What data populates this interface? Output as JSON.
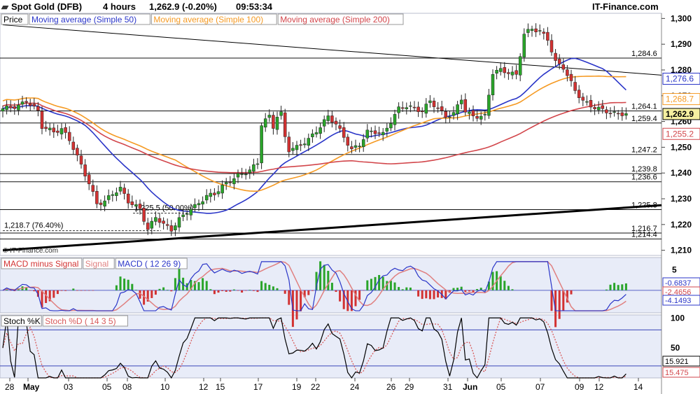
{
  "header": {
    "instrument": "Spot Gold (DFB)",
    "timeframe": "4 hours",
    "price": "1,262.9 (-0.20%)",
    "time": "09:53:34",
    "brand": "IT-Finance.com"
  },
  "colors": {
    "panel_bg": "#e8ecf8",
    "price_label_bg": "#f5f0a0",
    "ma50": "#2a35c8",
    "ma100": "#f59a23",
    "ma200": "#d2464b",
    "macd_line": "#2a35c8",
    "signal_line": "#e08080",
    "hist_pos": "#2aa52a",
    "hist_neg": "#d23232",
    "stoch_k": "#000000",
    "stoch_d": "#d85a5a",
    "candle_up": "#2aa52a",
    "candle_down": "#d23232"
  },
  "legends": {
    "price": [
      "Price",
      "Moving average (Simple 50)",
      "Moving average (Simple 100)",
      "Moving average (Simple 200)"
    ],
    "macd": [
      "MACD minus Signal",
      "Signal",
      "MACD ( 12 26 9)"
    ],
    "stoch": [
      "Stoch %K",
      "Stoch %D ( 14 3 5)"
    ]
  },
  "watermark": "© IT-Finance.com",
  "chart_data": {
    "type": "candlestick",
    "price_axis": {
      "range": [
        1208,
        1302
      ],
      "ticks": [
        "1,300",
        "1,290",
        "1,280",
        "1,270",
        "1,260",
        "1,250",
        "1,240",
        "1,230",
        "1,220",
        "1,210"
      ]
    },
    "x_ticks": [
      "28",
      "May",
      "03",
      "05",
      "08",
      "10",
      "12",
      "15",
      "17",
      "19",
      "22",
      "24",
      "26",
      "29",
      "31",
      "Jun",
      "05",
      "07",
      "09",
      "12",
      "14"
    ],
    "horizontal_levels": [
      {
        "value": 1284.6,
        "label": "1,284.6"
      },
      {
        "value": 1264.1,
        "label": "1,264.1"
      },
      {
        "value": 1259.4,
        "label": "1,259.4"
      },
      {
        "value": 1247.2,
        "label": "1,247.2"
      },
      {
        "value": 1239.8,
        "label": "1,239.8"
      },
      {
        "value": 1236.6,
        "label": "1,236.6"
      },
      {
        "value": 1225.8,
        "label": "1,225.8"
      },
      {
        "value": 1216.7,
        "label": "1,216.7"
      },
      {
        "value": 1214.4,
        "label": "1,214.4"
      }
    ],
    "fib_labels": [
      {
        "value": 1225.5,
        "label": "1,225.5 (50.00%)"
      },
      {
        "value": 1218.7,
        "label": "1,218.7 (76.40%)"
      }
    ],
    "price_labels": [
      {
        "value": 1276.6,
        "text": "1,276.6",
        "series": "ma50"
      },
      {
        "value": 1268.7,
        "text": "1,268.7",
        "series": "ma100"
      },
      {
        "value": 1262.9,
        "text": "1,262.9",
        "series": "last"
      },
      {
        "value": 1255.2,
        "text": "1,255.2",
        "series": "ma200"
      }
    ],
    "trendlines": [
      {
        "from": [
          0,
          1297.5
        ],
        "to": [
          158,
          1278
        ],
        "color": "#000000",
        "note": "descending resistance"
      },
      {
        "from": [
          0,
          1210
        ],
        "to": [
          158,
          1227.5
        ],
        "color": "#000000",
        "note": "rising support"
      }
    ],
    "key_closes": [
      [
        0,
        1265
      ],
      [
        4,
        1266
      ],
      [
        6,
        1268
      ],
      [
        9,
        1264
      ],
      [
        10,
        1258
      ],
      [
        13,
        1256
      ],
      [
        15,
        1257
      ],
      [
        17,
        1253
      ],
      [
        20,
        1243
      ],
      [
        22,
        1236
      ],
      [
        24,
        1228
      ],
      [
        26,
        1229
      ],
      [
        28,
        1232
      ],
      [
        30,
        1234
      ],
      [
        32,
        1229
      ],
      [
        35,
        1226
      ],
      [
        37,
        1218
      ],
      [
        39,
        1223
      ],
      [
        41,
        1220
      ],
      [
        43,
        1218
      ],
      [
        45,
        1222
      ],
      [
        47,
        1225
      ],
      [
        49,
        1227
      ],
      [
        52,
        1231
      ],
      [
        54,
        1232
      ],
      [
        57,
        1236
      ],
      [
        60,
        1239
      ],
      [
        63,
        1241
      ],
      [
        65,
        1244
      ],
      [
        66,
        1259
      ],
      [
        68,
        1262
      ],
      [
        69,
        1258
      ],
      [
        70,
        1262
      ],
      [
        71,
        1263
      ],
      [
        72,
        1254
      ],
      [
        73,
        1249
      ],
      [
        75,
        1250
      ],
      [
        78,
        1253
      ],
      [
        81,
        1258
      ],
      [
        83,
        1262
      ],
      [
        85,
        1259
      ],
      [
        87,
        1254
      ],
      [
        89,
        1249
      ],
      [
        91,
        1251
      ],
      [
        93,
        1256
      ],
      [
        95,
        1256
      ],
      [
        97,
        1255
      ],
      [
        99,
        1260
      ],
      [
        101,
        1265
      ],
      [
        103,
        1266
      ],
      [
        105,
        1265
      ],
      [
        107,
        1264
      ],
      [
        109,
        1268
      ],
      [
        111,
        1265
      ],
      [
        113,
        1262
      ],
      [
        115,
        1263
      ],
      [
        117,
        1269
      ],
      [
        118,
        1264
      ],
      [
        120,
        1262
      ],
      [
        123,
        1262
      ],
      [
        125,
        1279
      ],
      [
        127,
        1280
      ],
      [
        129,
        1279
      ],
      [
        131,
        1278
      ],
      [
        133,
        1294
      ],
      [
        135,
        1296
      ],
      [
        137,
        1295
      ],
      [
        139,
        1292
      ],
      [
        141,
        1283
      ],
      [
        143,
        1281
      ],
      [
        144,
        1278
      ],
      [
        146,
        1272
      ],
      [
        148,
        1268
      ],
      [
        150,
        1266
      ],
      [
        152,
        1265
      ],
      [
        154,
        1264
      ],
      [
        156,
        1263
      ],
      [
        158,
        1263
      ]
    ],
    "macd": {
      "range": [
        -5.5,
        8
      ],
      "ticks": [
        "5",
        "0"
      ],
      "labels": [
        {
          "value": -0.6837,
          "text": "-0.6837"
        },
        {
          "value": -2.4656,
          "text": "-2.4656"
        },
        {
          "value": -4.1493,
          "text": "-4.1493"
        }
      ]
    },
    "stochastic": {
      "range": [
        0,
        105
      ],
      "ticks": [
        "100",
        "50"
      ],
      "levels": [
        80,
        20
      ],
      "labels": [
        {
          "value": 15.921,
          "text": "15.921"
        },
        {
          "value": 15.475,
          "text": "15.475"
        }
      ]
    }
  }
}
